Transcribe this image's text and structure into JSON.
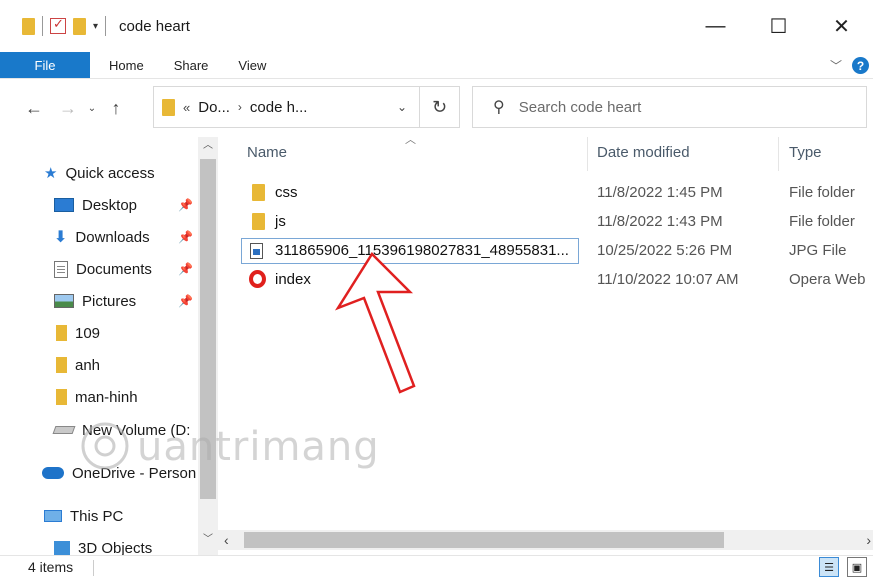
{
  "window": {
    "title": "code heart",
    "controls": {
      "minimize": "—",
      "maximize": "☐",
      "close": "✕"
    }
  },
  "ribbon": {
    "tabs": [
      {
        "label": "File"
      },
      {
        "label": "Home"
      },
      {
        "label": "Share"
      },
      {
        "label": "View"
      }
    ],
    "accent": "#1979ca",
    "help": "?"
  },
  "address": {
    "crumbs": [
      "«",
      "Do...",
      "code h..."
    ],
    "search_placeholder": "Search code heart"
  },
  "nav": {
    "items": [
      {
        "label": "Quick access",
        "icon": "star-icon"
      },
      {
        "label": "Desktop",
        "icon": "desktop-icon",
        "pinned": true
      },
      {
        "label": "Downloads",
        "icon": "downloads-icon",
        "pinned": true
      },
      {
        "label": "Documents",
        "icon": "documents-icon",
        "pinned": true
      },
      {
        "label": "Pictures",
        "icon": "pictures-icon",
        "pinned": true
      },
      {
        "label": "109",
        "icon": "folder-icon"
      },
      {
        "label": "anh",
        "icon": "folder-icon"
      },
      {
        "label": "man-hinh",
        "icon": "folder-icon"
      },
      {
        "label": "New Volume (D:",
        "icon": "drive-icon"
      },
      {
        "label": "OneDrive - Person",
        "icon": "onedrive-icon"
      },
      {
        "label": "This PC",
        "icon": "this-pc-icon"
      },
      {
        "label": "3D Objects",
        "icon": "3d-objects-icon"
      }
    ]
  },
  "list": {
    "columns": {
      "name": "Name",
      "date": "Date modified",
      "type": "Type"
    },
    "rows": [
      {
        "name": "css",
        "date": "11/8/2022 1:45 PM",
        "type": "File folder",
        "icon": "folder-icon"
      },
      {
        "name": "js",
        "date": "11/8/2022 1:43 PM",
        "type": "File folder",
        "icon": "folder-icon"
      },
      {
        "name": "311865906_115396198027831_48955831...",
        "date": "10/25/2022 5:26 PM",
        "type": "JPG File",
        "icon": "jpg-file-icon",
        "selected": true
      },
      {
        "name": "index",
        "date": "11/10/2022 10:07 AM",
        "type": "Opera Web",
        "icon": "opera-icon"
      }
    ]
  },
  "status": {
    "count": "4 items"
  },
  "annotation": {
    "arrow_color": "#e02020"
  }
}
